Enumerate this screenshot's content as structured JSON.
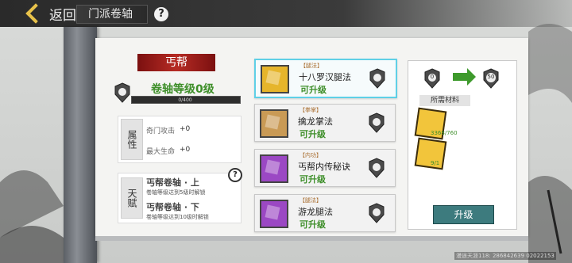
{
  "topbar": {
    "back_label": "返回",
    "title": "门派卷轴",
    "help": "?"
  },
  "left_panel": {
    "sect_name": "丐帮",
    "scroll_level": "卷轴等级0级",
    "xp_progress": "0/400",
    "attributes": {
      "label": "属性",
      "rows": [
        {
          "name": "奇门攻击",
          "value": "+0"
        },
        {
          "name": "最大生命",
          "value": "+0"
        }
      ]
    },
    "talents": {
      "label": "天赋",
      "items": [
        {
          "name": "丐帮卷轴 · 上",
          "desc": "卷轴等级达到5级时解锁"
        },
        {
          "name": "丐帮卷轴 · 下",
          "desc": "卷轴等级达到10级时解锁"
        }
      ],
      "help": "?"
    }
  },
  "skills": [
    {
      "type": "【腿法】",
      "name": "十八罗汉腿法",
      "status": "可升级",
      "level": "0",
      "color": "#e6b52b",
      "selected": true
    },
    {
      "type": "【拳掌】",
      "name": "擒龙掌法",
      "status": "可升级",
      "level": "0",
      "color": "#c99a55",
      "selected": false
    },
    {
      "type": "【内功】",
      "name": "丐帮内传秘诀",
      "status": "可升级",
      "level": "0",
      "color": "#9b48c4",
      "selected": false
    },
    {
      "type": "【腿法】",
      "name": "游龙腿法",
      "status": "可升级",
      "level": "0",
      "color": "#9b48c4",
      "selected": false
    }
  ],
  "upgrade_panel": {
    "from_level": "0",
    "to_level": "50",
    "materials_title": "所需材料",
    "materials": [
      {
        "qty": "3368/760"
      },
      {
        "qty": "9/1"
      }
    ],
    "upgrade_label": "升级"
  },
  "footer": {
    "text": "漫途天涯118: 286842639  02022153"
  }
}
